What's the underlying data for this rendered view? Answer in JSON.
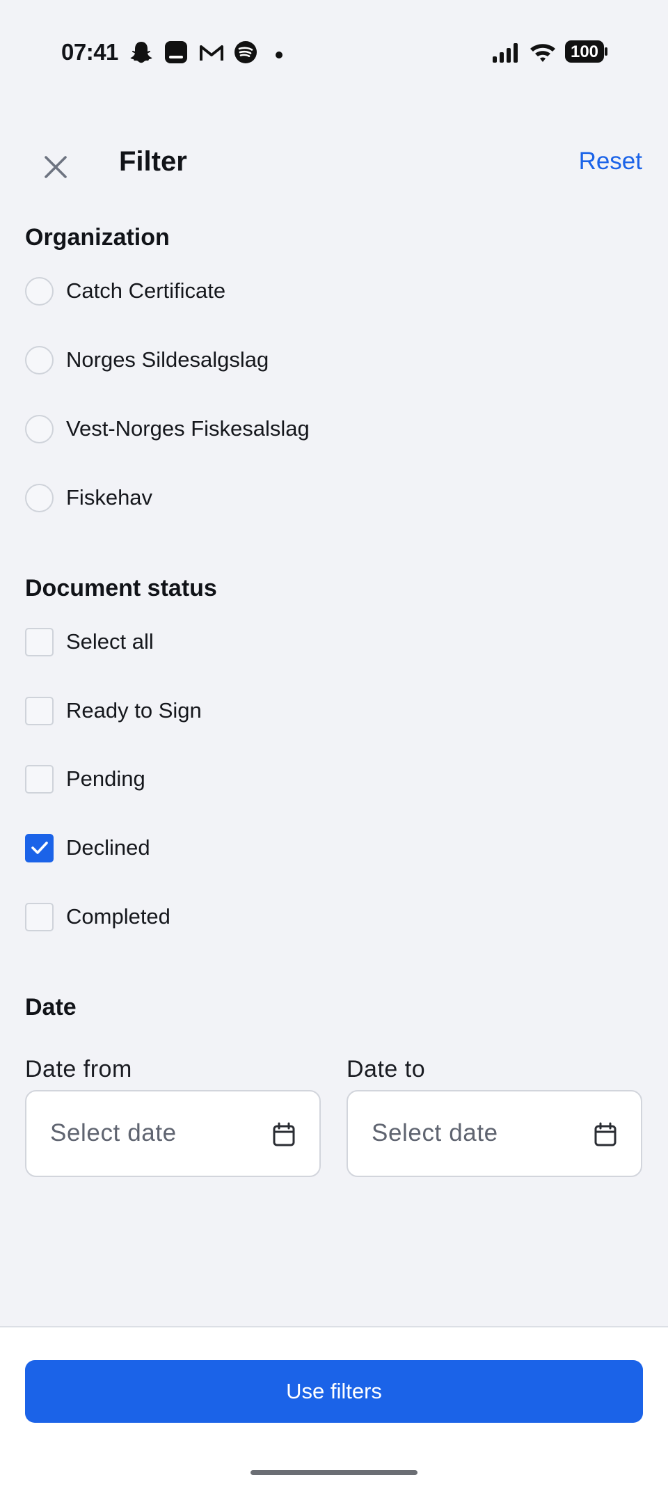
{
  "status_bar": {
    "time": "07:41",
    "battery": "100",
    "left_icons": [
      "snapchat-icon",
      "app-icon",
      "gmail-icon",
      "spotify-icon",
      "dot-icon"
    ],
    "right_icons": [
      "signal-icon",
      "wifi-icon",
      "battery-icon"
    ]
  },
  "header": {
    "title": "Filter",
    "reset_label": "Reset",
    "close_icon": "close-icon"
  },
  "organization": {
    "title": "Organization",
    "options": [
      {
        "label": "Catch Certificate",
        "selected": false
      },
      {
        "label": "Norges Sildesalgslag",
        "selected": false
      },
      {
        "label": "Vest-Norges Fiskesalslag",
        "selected": false
      },
      {
        "label": "Fiskehav",
        "selected": false
      }
    ]
  },
  "document_status": {
    "title": "Document status",
    "options": [
      {
        "label": "Select all",
        "checked": false
      },
      {
        "label": "Ready to Sign",
        "checked": false
      },
      {
        "label": "Pending",
        "checked": false
      },
      {
        "label": "Declined",
        "checked": true
      },
      {
        "label": "Completed",
        "checked": false
      }
    ]
  },
  "date": {
    "title": "Date",
    "from_label": "Date from",
    "to_label": "Date to",
    "from_placeholder": "Select date",
    "to_placeholder": "Select date",
    "icon": "calendar-icon"
  },
  "footer": {
    "button_label": "Use filters"
  },
  "colors": {
    "accent": "#1b63e8",
    "background": "#f2f3f7"
  }
}
